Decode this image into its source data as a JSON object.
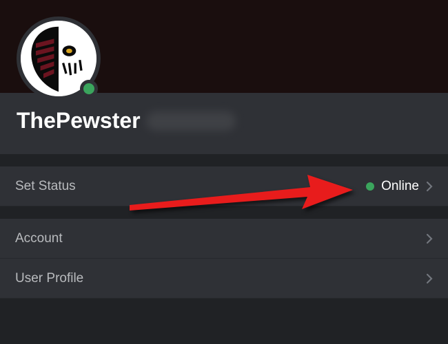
{
  "profile": {
    "username": "ThePewster",
    "presence": "online"
  },
  "settings": {
    "setStatus": {
      "label": "Set Status",
      "value": "Online"
    },
    "items": [
      {
        "label": "Account"
      },
      {
        "label": "User Profile"
      }
    ]
  },
  "colors": {
    "onlineGreen": "#3ba55d",
    "arrowRed": "#e81c1c"
  }
}
